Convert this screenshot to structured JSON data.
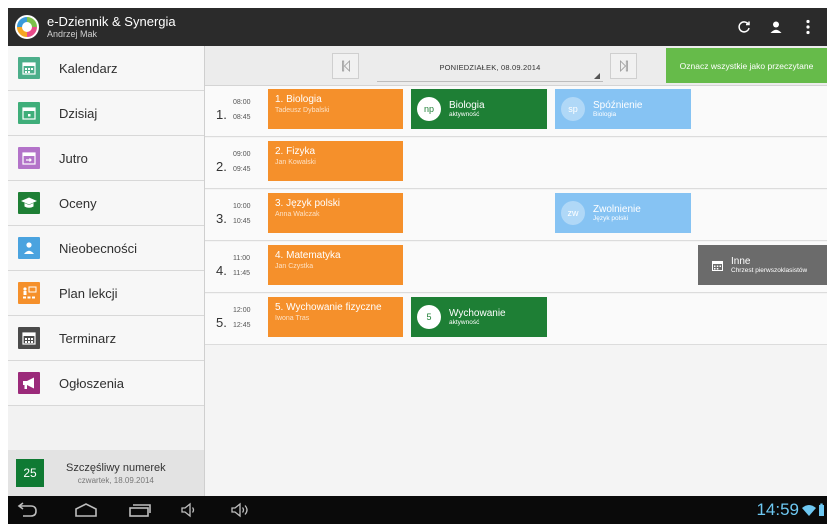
{
  "app": {
    "title": "e-Dziennik & Synergia",
    "user": "Andrzej Mak",
    "icons": [
      "refresh-icon",
      "user-icon",
      "overflow-menu-icon"
    ]
  },
  "colors": {
    "lesson": "#f5902b",
    "note_green": "#1e7f35",
    "note_blue": "#86c3f3",
    "note_grey": "#6b6b6b",
    "mark_all_button": "#66bb4a",
    "clock": "#6ec8f2"
  },
  "sidebar": {
    "items": [
      {
        "label": "Kalendarz",
        "icon": "calendar-icon",
        "color": "#4cae8a"
      },
      {
        "label": "Dzisiaj",
        "icon": "calendar-today-icon",
        "color": "#3fae7a"
      },
      {
        "label": "Jutro",
        "icon": "calendar-tomorrow-icon",
        "color": "#b373c9"
      },
      {
        "label": "Oceny",
        "icon": "graduation-cap-icon",
        "color": "#1e7f35"
      },
      {
        "label": "Nieobecności",
        "icon": "absence-person-icon",
        "color": "#4aa3df"
      },
      {
        "label": "Plan lekcji",
        "icon": "classroom-icon",
        "color": "#f5902b"
      },
      {
        "label": "Terminarz",
        "icon": "schedule-icon",
        "color": "#4a4a4a"
      },
      {
        "label": "Ogłoszenia",
        "icon": "megaphone-icon",
        "color": "#9b2a7a"
      }
    ],
    "lucky": {
      "number": "25",
      "title": "Szczęśliwy numerek",
      "date": "czwartek, 18.09.2014"
    }
  },
  "daybar": {
    "date": "PONIEDZIAŁEK, 08.09.2014",
    "mark_all": "Oznacz wszystkie jako przeczytane"
  },
  "lessons": [
    {
      "num": "1.",
      "start": "08:00",
      "end": "08:45",
      "title": "1. Biologia",
      "teacher": "Tadeusz Dybalski",
      "green": {
        "badge": "np",
        "title": "Biologia",
        "sub": "aktywność"
      },
      "blue": {
        "badge": "sp",
        "title": "Spóźnienie",
        "sub": "Biologia"
      }
    },
    {
      "num": "2.",
      "start": "09:00",
      "end": "09:45",
      "title": "2. Fizyka",
      "teacher": "Jan Kowalski"
    },
    {
      "num": "3.",
      "start": "10:00",
      "end": "10:45",
      "title": "3. Język polski",
      "teacher": "Anna Walczak",
      "blue": {
        "badge": "zw",
        "title": "Zwolnienie",
        "sub": "Język polski"
      }
    },
    {
      "num": "4.",
      "start": "11:00",
      "end": "11:45",
      "title": "4. Matematyka",
      "teacher": "Jan Czystka",
      "grey": {
        "title": "Inne",
        "sub": "Chrzest pierwszoklasistów"
      }
    },
    {
      "num": "5.",
      "start": "12:00",
      "end": "12:45",
      "title": "5. Wychowanie fizyczne",
      "teacher": "Iwona Tras",
      "green": {
        "badge": "5",
        "title": "Wychowanie",
        "sub": "aktywność"
      }
    }
  ],
  "navbar": {
    "time": "14:59",
    "icons": [
      "back-icon",
      "home-icon",
      "recent-apps-icon",
      "volume-down-icon",
      "volume-up-icon",
      "wifi-icon",
      "battery-icon"
    ]
  }
}
